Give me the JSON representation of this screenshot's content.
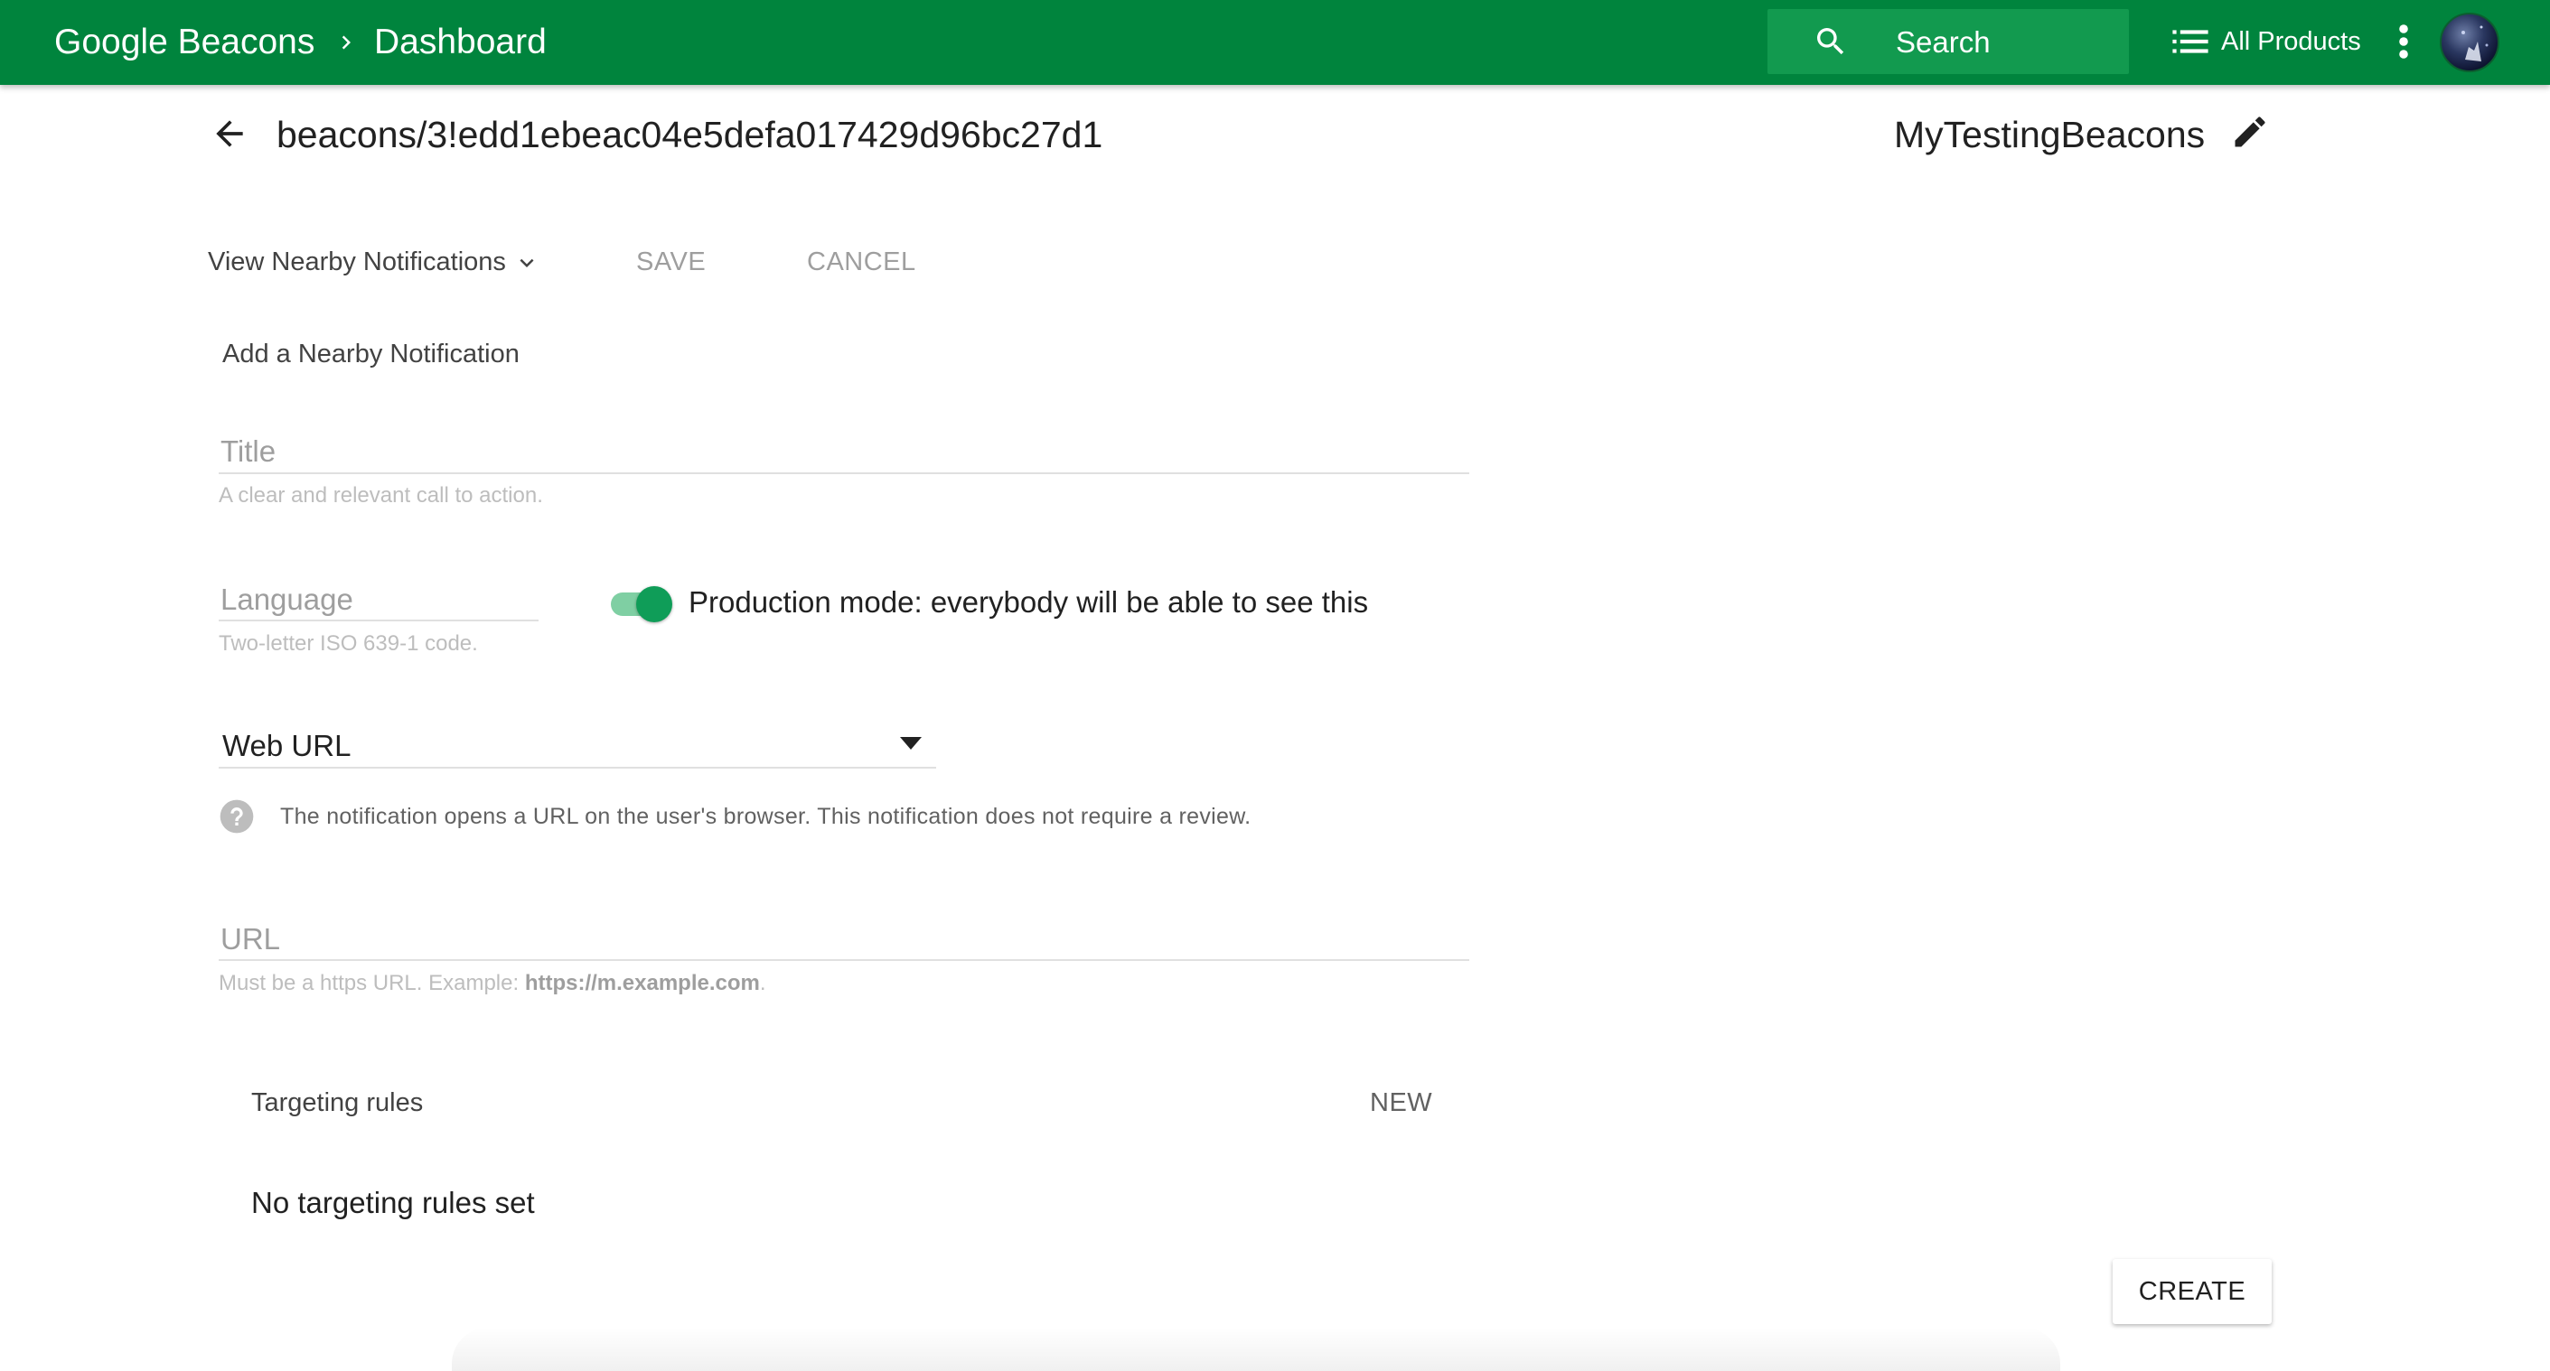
{
  "header": {
    "app_name": "Google Beacons",
    "page_name": "Dashboard",
    "search_label": "Search",
    "all_products_label": "All Products",
    "brand_color": "#00843d"
  },
  "resource": {
    "beacon_id": "beacons/3!edd1ebeac04e5defa017429d96bc27d1",
    "project_name": "MyTestingBeacons"
  },
  "toolbar": {
    "view_selector": "View Nearby Notifications",
    "save_label": "SAVE",
    "cancel_label": "CANCEL"
  },
  "form": {
    "heading": "Add a Nearby Notification",
    "title": {
      "value": "",
      "placeholder": "Title",
      "helper": "A clear and relevant call to action."
    },
    "language": {
      "value": "",
      "placeholder": "Language",
      "helper": "Two-letter ISO 639-1 code."
    },
    "production_mode": {
      "enabled": true,
      "label": "Production mode: everybody will be able to see this"
    },
    "notification_type": {
      "selected": "Web URL",
      "hint": "The notification opens a URL on the user's browser. This notification does not require a review."
    },
    "url": {
      "value": "",
      "placeholder": "URL",
      "helper_prefix": "Must be a https URL. Example: ",
      "helper_example": "https://m.example.com",
      "helper_suffix": "."
    }
  },
  "targeting": {
    "heading": "Targeting rules",
    "new_label": "NEW",
    "empty_text": "No targeting rules set"
  },
  "actions": {
    "create_label": "CREATE"
  },
  "icons": {
    "breadcrumb_separator": "chevron-right-icon",
    "search": "search-icon",
    "all_products": "list-icon",
    "more": "more-vert-icon",
    "back": "arrow-back-icon",
    "edit": "pencil-icon",
    "dropdown": "chevron-down-icon",
    "select": "caret-down-icon",
    "help": "help-icon"
  }
}
